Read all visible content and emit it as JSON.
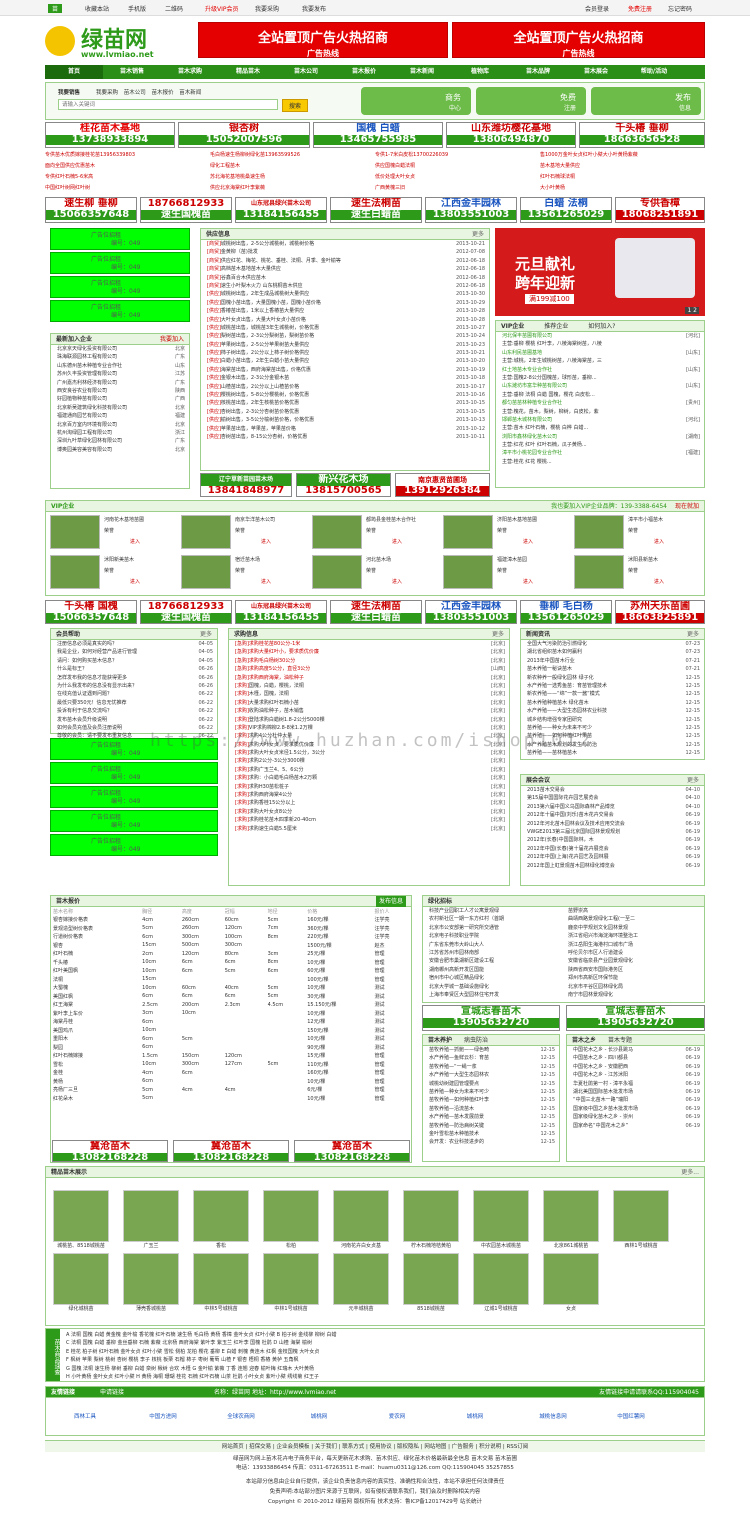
{
  "topbar": {
    "home": "收藏本站",
    "mobile": "手机版",
    "qr": "二维码",
    "vip": "升级VIP会员",
    "buy": "我要采购",
    "pub": "我要发布",
    "login": "会员登录",
    "reg": "免费注册",
    "forgot": "忘记密码"
  },
  "logo": {
    "name": "绿苗网",
    "url": "www.lvmiao.net"
  },
  "top_ads": [
    {
      "title": "全站置顶广告火热招商",
      "sub": "广告热线"
    },
    {
      "title": "全站置顶广告火热招商",
      "sub": "广告热线"
    }
  ],
  "nav": [
    "首页",
    "苗木销售",
    "苗木求购",
    "精品苗木",
    "苗木公司",
    "苗木报价",
    "苗木新闻",
    "植物库",
    "苗木品牌",
    "苗木展会",
    "帮助/活动"
  ],
  "search": {
    "label": "我要销售",
    "tabs": [
      "我要采购",
      "苗木公司",
      "苗木报价",
      "苗木新闻"
    ],
    "placeholder": "请输入关键词",
    "button": "搜索"
  },
  "quick": [
    {
      "a": "商",
      "b": "务",
      "c": "中心"
    },
    {
      "a": "免",
      "b": "费",
      "c": "注册"
    },
    {
      "a": "发",
      "b": "布",
      "c": "信息"
    }
  ],
  "banners1": [
    {
      "a": "桂花苗木基地",
      "b": "13738933894"
    },
    {
      "a": "银杏树",
      "b": "15052007596"
    },
    {
      "a": "国槐 白蜡",
      "b": "13465755985"
    },
    {
      "a": "山东潍坊樱花基地",
      "b": "13806494870"
    },
    {
      "a": "千头椿 垂柳",
      "b": "18663656528"
    }
  ],
  "notice": [
    [
      "专供苗木优质嫁接桂花苗13956339803",
      "毛白杨速生杨柳树绿化苗13963599526",
      "专供1-7米白皮松13700226039",
      "售1000万金叶女贞红叶小檗大小叶黄杨紫薇"
    ],
    [
      "面向全国供应优惠苗木",
      "绿化工程苗木",
      "供应国槐白蜡法桐",
      "苗木基地大量供应"
    ],
    [
      "专供红叶石楠5-6米高",
      "苏北海花基地桃桑速生杨",
      "低价处理大叶女贞",
      "红叶石楠球法桐"
    ],
    [
      "中国红叶树网红叶树",
      "供应北京海棠红叶李紫薇",
      "广西黄槐三旧",
      "大小叶黄杨"
    ]
  ],
  "banners2": [
    {
      "a": "速生柳 垂柳",
      "b": "15066357648"
    },
    {
      "a": "18766812933",
      "b": "速生国槐苗"
    },
    {
      "a": "山东冠县绿兴苗木公司",
      "b": "13184156455"
    },
    {
      "a": "速生法桐苗",
      "b": "速生白蜡苗"
    },
    {
      "a": "江西金丰园林",
      "b": "13803551003"
    },
    {
      "a": "白蜡 法桐",
      "b": "13561265029"
    },
    {
      "a": "专供香樟",
      "b": "18068251891"
    }
  ],
  "ad_slots": {
    "label": "广告位招租",
    "code": "编号：049"
  },
  "new_companies": {
    "title": "最新加入企业",
    "more": "我要加入",
    "items": [
      [
        "北京京天绿化投资有限公司",
        "北京"
      ],
      [
        "珠海联源园林工程有限公司",
        "广东"
      ],
      [
        "山东德州苗木种植专业合作社",
        "山东"
      ],
      [
        "苏州久丰投资管理有限公司",
        "江苏"
      ],
      [
        "广州嘉杰利林经济有限公司",
        "广东"
      ],
      [
        "西安良谷农业有限公司",
        "陕西"
      ],
      [
        "好园植物种苗有限公司",
        "广西"
      ],
      [
        "北京新吴建筑绿化科技有限公司",
        "北京"
      ],
      [
        "福建通商园艺有限公司",
        "福建"
      ],
      [
        "北京百方室内环境有限公司",
        "北京"
      ],
      [
        "杭州淘绿园工程有限公司",
        "浙江"
      ],
      [
        "深圳九叶草绿化园林有限公司",
        "广东"
      ],
      [
        "博奥园美容美容有限公司",
        "北京"
      ]
    ]
  },
  "supply": {
    "title": "供应信息",
    "more": "更多",
    "items": [
      [
        "[商贸]",
        "城桃树出售，2-5公分城桃树，城桃树价格",
        "2013-10-21"
      ],
      [
        "[商贸]",
        "金黄柳（苗)批发",
        "2012-07-08"
      ],
      [
        "[商贸]",
        "供应红花、梅花、桃花、垂桂、法桐、月季、金叶榆等",
        "2012-06-18"
      ],
      [
        "[商贸]",
        "高档苗木基地苗木大量供应",
        "2012-06-18"
      ],
      [
        "[商贸]",
        "谷鑫百合木供应苗木",
        "2012-06-18"
      ],
      [
        "[商贸]",
        "速生小叶梨木火力 山东桃桐苗木供应",
        "2012-06-18"
      ],
      [
        "[供应]",
        "城桃树出售，2年生成品城桃树大量供应",
        "2013-10-30"
      ],
      [
        "[供应]",
        "国槐小苗出售，大量国槐小苗，国槐小苗价格",
        "2013-10-29"
      ],
      [
        "[供应]",
        "香椿苗出售，1米以上香椿苗大量供应",
        "2013-10-28"
      ],
      [
        "[供应]",
        "大叶女贞出售，大量大叶女贞小苗价格",
        "2013-10-28"
      ],
      [
        "[供应]",
        "城桃苗出售，城桃苗3年生城桃树，价格优惠",
        "2013-10-27"
      ],
      [
        "[供应]",
        "梨树苗出售，2-3公分梨树苗，梨树苗价格",
        "2013-10-24"
      ],
      [
        "[供应]",
        "苹果树出售，2-5公分苹果树苗大量供应",
        "2013-10-23"
      ],
      [
        "[供应]",
        "柿子树出售，2公分以上柿子树价格供应",
        "2013-10-21"
      ],
      [
        "[供应]",
        "白蜡小苗出售，2年生白蜡小苗大量供应",
        "2013-10-20"
      ],
      [
        "[供应]",
        "海棠苗出售，西府海棠苗出售，价格优惠",
        "2013-10-19"
      ],
      [
        "[供应]",
        "金银木出售，2-3公分金银木苗",
        "2013-10-18"
      ],
      [
        "[供应]",
        "山楂苗出售，2公分以上山楂苗价格",
        "2013-10-17"
      ],
      [
        "[供应]",
        "樱桃树出售，5-8公分樱桃树，价格优惠",
        "2013-10-16"
      ],
      [
        "[供应]",
        "核桃苗出售，2年生核桃苗价格优惠",
        "2013-10-15"
      ],
      [
        "[供应]",
        "杏树出售，2-3公分杏树苗价格优惠",
        "2013-10-15"
      ],
      [
        "[供应]",
        "榆树出售，3-5公分榆树苗价格，价格优惠",
        "2013-10-13"
      ],
      [
        "[供应]",
        "苹果苗出售，苹果苗，苹果苗价格",
        "2013-10-12"
      ],
      [
        "[供应]",
        "杏树苗出售，8-15公分杏树，价格优惠",
        "2013-10-11"
      ]
    ]
  },
  "promo": {
    "t1": "元旦献礼",
    "t2": "跨年迎新",
    "t3": "满199减100",
    "pages": "1 2"
  },
  "vip_tabs": [
    "VIP企业",
    "推荐企业",
    "如何加入?"
  ],
  "vip_list": [
    [
      "河北保丰苗圃有限公司",
      "[河北]"
    ],
    [
      "主营:垂柳 樱桃 红叶李，八棱海棠树苗，八棱",
      ""
    ],
    [
      "山东利民苗圃基地",
      "[山东]"
    ],
    [
      "主营:城桃，2年生城桃树苗，八棱海棠苗，三",
      ""
    ],
    [
      "红土地苗木专业合作社",
      "[山东]"
    ],
    [
      "主营:国槐2-8公分国槐苗，球形苗，垂柳...",
      ""
    ],
    [
      "山东潍坊市富华种苗有限公司",
      "[山东]"
    ],
    [
      "主营:垂柳 法桐 白蜡 国槐，樱花 白皮松...",
      ""
    ],
    [
      "都匀苗苗林种植专业合作社",
      "[贵州]"
    ],
    [
      "主营:槐花，苗木，梨树，柳树，白皮松，紫",
      ""
    ],
    [
      "邯郸苗木城林有限公司",
      "[河北]"
    ],
    [
      "主营:苗木 红叶石楠，樱桃 白桦 白蜡...",
      ""
    ],
    [
      "浏阳市鑫林绿化苗木公司",
      "[湖南]"
    ],
    [
      "主营:红花 红叶 红叶石楠，瓜子黄杨...",
      ""
    ],
    [
      "漳平市小桃花园专业合作社",
      "[福建]"
    ],
    [
      "主营:桂花 红花 樱桃...",
      ""
    ]
  ],
  "banners3": [
    {
      "a": "辽宁草新苗园苗木场",
      "b": "13841848977"
    },
    {
      "a": "新兴花木场",
      "b": "13815700565"
    },
    {
      "a": "南京惠贤苗圃场",
      "b": "13912926384"
    }
  ],
  "vip_enterprise": {
    "title": "VIP企业",
    "right": "我也要加入VIP企业品牌：139-3388-6454",
    "more": "现在就加",
    "items": [
      {
        "n": "河南花木基地苗圃",
        "r": "荣誉",
        "p": "进入"
      },
      {
        "n": "南京华洋苗木公司",
        "r": "荣誉",
        "p": "进入"
      },
      {
        "n": "都筠县金桂苗木合作社",
        "r": "荣誉",
        "p": "进入"
      },
      {
        "n": "济阳苗木基地苗圃",
        "r": "荣誉",
        "p": "进入"
      },
      {
        "n": "漳平市小福苗木",
        "r": "荣誉",
        "p": "进入"
      },
      {
        "n": "沭阳新美苗木",
        "r": "荣誉",
        "p": "进入"
      },
      {
        "n": "宿迁苗木场",
        "r": "荣誉",
        "p": "进入"
      },
      {
        "n": "河北苗木场",
        "r": "荣誉",
        "p": "进入"
      },
      {
        "n": "福建漳木苗园",
        "r": "荣誉",
        "p": "进入"
      },
      {
        "n": "沭阳县新苗木",
        "r": "荣誉",
        "p": "进入"
      }
    ]
  },
  "banners4": [
    {
      "a": "千头椿 国槐",
      "b": "15066357648"
    },
    {
      "a": "18766812933",
      "b": "速生国槐苗"
    },
    {
      "a": "山东冠县绿兴苗木公司",
      "b": "13184156455"
    },
    {
      "a": "速生法桐苗",
      "b": "速生白蜡苗"
    },
    {
      "a": "江西金丰园林",
      "b": "13803551003"
    },
    {
      "a": "垂柳 毛白杨",
      "b": "13561265029"
    },
    {
      "a": "苏州天乐苗圃",
      "b": "18663825891"
    }
  ],
  "help": {
    "title": "会员帮助",
    "more": "更多",
    "items": [
      [
        "注册信息必须是真实的吗？",
        "04-05"
      ],
      [
        "我是企业，如何对经营产品进行管理",
        "04-05"
      ],
      [
        "请问：如何购买苗木信息？",
        "04-05"
      ],
      [
        "什么是标王？",
        "06-26"
      ],
      [
        "怎样发布我的信息才能获得更多",
        "06-26"
      ],
      [
        "为什么我发布的信息没有显示出来？",
        "06-26"
      ],
      [
        "在线充值认证遇到问题？",
        "06-22"
      ],
      [
        "最低只要350元！信息无忧推荐",
        "06-22"
      ],
      [
        "投诉有利于信息交流吗？",
        "06-22"
      ],
      [
        "发布苗木会员升级说明",
        "06-22"
      ],
      [
        "如何会员充值及会员注册说明",
        "06-22"
      ],
      [
        "尊敬的会员：请不要发布重复信息",
        "06-22"
      ]
    ]
  },
  "buying": {
    "title": "求购信息",
    "more": "更多",
    "items": [
      [
        "[急购]",
        "求购桂花苗80公分-1米",
        "[北京]"
      ],
      [
        "[急购]",
        "求购大量红叶小，要求质优价廉",
        "[北京]"
      ],
      [
        "[急购]",
        "求购毛白杨树30公分",
        "[北京]"
      ],
      [
        "[急购]",
        "求购高度5公分，直径3公分",
        "[山西]"
      ],
      [
        "[急购]",
        "求购西府海棠，油松种子",
        "[北京]"
      ],
      [
        "[求购]",
        "国槐，白蜡，樱桃，法桐",
        "[北京]"
      ],
      [
        "[求购]",
        "木槿，国槐，法桐",
        "[北京]"
      ],
      [
        "[求购]",
        "大量求购红叶石楠小苗",
        "[北京]"
      ],
      [
        "[求购]",
        "收购油松种子，苗木销售",
        "[北京]"
      ],
      [
        "[求购]",
        "登陆求购白蜡树1.8-2公分5000棵",
        "[北京]"
      ],
      [
        "[求购]",
        "VIP求购棉柳2.8-8米1.2万棵",
        "[北京]"
      ],
      [
        "[求购]",
        "求购4公分杜仲大量",
        "[北京]"
      ],
      [
        "[求购]",
        "求购大叶女贞，要求质优价廉",
        "[北京]"
      ],
      [
        "[求购]",
        "求购大叶女贞米径1.5公分，3公分",
        "[北京]"
      ],
      [
        "[求购]",
        "求购2公分-3公分3000棵",
        "[北京]"
      ],
      [
        "[求购]",
        "求购广玉兰4、5、6公分",
        "[北京]"
      ],
      [
        "[求购]",
        "求购：小白蜡毛白杨苗木2万颗",
        "[北京]"
      ],
      [
        "[求购]",
        "求购H30苗松桩子",
        "[北京]"
      ],
      [
        "[求购]",
        "求购西府海棠4公分",
        "[北京]"
      ],
      [
        "[求购]",
        "求购香桂15公分以上",
        "[北京]"
      ],
      [
        "[求购]",
        "求购大叶女贞8公分",
        "[北京]"
      ],
      [
        "[求购]",
        "求购桂花苗木四季新20-40cm",
        "[北京]"
      ],
      [
        "[求购]",
        "求购速生白蜡5.5厘米",
        "[北京]"
      ]
    ]
  },
  "news": {
    "title": "新闻资讯",
    "more": "更多",
    "items": [
      [
        "全国大气污染防治引燃绿化",
        "07-23"
      ],
      [
        "湖北省组织苗木如何赢利",
        "07-23"
      ],
      [
        "2013年中国苗木行业",
        "07-21"
      ],
      [
        "苗木养殖一秘诀苗木",
        "07-21"
      ],
      [
        "新农种养一般绿化园林 绿子化",
        "12-15"
      ],
      [
        "水产养殖一选秀鱼苗：育苗管理技术",
        "12-15"
      ],
      [
        "新农养殖——“绵”一款一酱“模式",
        "12-15"
      ],
      [
        "苗木养殖种植苗木 绿化苗木",
        "12-15"
      ],
      [
        "水产养殖——大型生态园林农业科技",
        "12-15"
      ],
      [
        "城乡结构增强专家团研究",
        "12-15"
      ],
      [
        "苗养殖——种女为未来不可少",
        "12-15"
      ],
      [
        "苗养殖——如何种植红叶果苗",
        "12-15"
      ],
      [
        "水产养殖苗木规划的发生与防治",
        "12-15"
      ],
      [
        "苗养殖——苗林植苗木",
        "12-15"
      ]
    ]
  },
  "expo": {
    "title": "展会会议",
    "more": "更多",
    "items": [
      [
        "2013苗木交易会",
        "04-10"
      ],
      [
        "第15届中国国际花卉园艺展览会",
        "04-10"
      ],
      [
        "2013第六届中国义乌国际森林产品博览",
        "04-10"
      ],
      [
        "2012年十届中国(刘乐)苗木花卉交易会",
        "06-19"
      ],
      [
        "2012年河北苗木园林会议及技术应用交流会",
        "06-19"
      ],
      [
        "VWGE2013第三届北京国际园林景观规划",
        "06-19"
      ],
      [
        "2012年(长春)中国国际林，木",
        "06-19"
      ],
      [
        "2012年中国(长春)第十届花卉展览会",
        "06-19"
      ],
      [
        "2012年中国(上海)花卉园艺及园林展",
        "06-19"
      ],
      [
        "2012年国上虹景观苗木园林绿化博览会",
        "06-19"
      ]
    ]
  },
  "price": {
    "title": "苗木报价",
    "btn": "发布信息",
    "cols": [
      "苗木名称",
      "胸径",
      "高度",
      "冠幅",
      "地径",
      "价格",
      "报价人"
    ],
    "rows": [
      [
        "银杏嫁接价格表",
        "4cm",
        "260cm",
        "60cm",
        "5cm",
        "160元/棵",
        "汪学亮"
      ],
      [
        "景观造型树价格表",
        "5cm",
        "260cm",
        "120cm",
        "7cm",
        "360元/棵",
        "汪学亮"
      ],
      [
        "行道树价格表",
        "6cm",
        "300cm",
        "100cm",
        "8cm",
        "220元/棵",
        "汪学亮"
      ],
      [
        "银杏",
        "15cm",
        "500cm",
        "300cm",
        "",
        "1500元/棵",
        "赵杰"
      ],
      [
        "红叶石楠",
        "2cm",
        "120cm",
        "80cm",
        "3cm",
        "25元/棵",
        "管理"
      ],
      [
        "千头椿",
        "10cm",
        "6cm",
        "6cm",
        "8cm",
        "10元/棵",
        "管理"
      ],
      [
        "红叶美国枫",
        "10cm",
        "6cm",
        "5cm",
        "6cm",
        "60元/棵",
        "管理"
      ],
      [
        "法桐",
        "15cm",
        "",
        "",
        "",
        "100元/棵",
        "管理"
      ],
      [
        "大蜀槐",
        "10cm",
        "60cm",
        "40cm",
        "5cm",
        "10元/棵",
        "测试"
      ],
      [
        "美国红枫",
        "6cm",
        "6cm",
        "6cm",
        "5cm",
        "30元/棵",
        "测试"
      ],
      [
        "红王海棠",
        "2.5cm",
        "200cm",
        "2.3cm",
        "4.5cm",
        "15.150元/棵",
        "测试"
      ],
      [
        "紫叶李上车价",
        "3cm",
        "10cm",
        "",
        "",
        "10元/棵",
        "测试"
      ],
      [
        "海棠丹桂",
        "6cm",
        "",
        "",
        "",
        "12元/棵",
        "测试"
      ],
      [
        "美国鸡爪",
        "10cm",
        "",
        "",
        "",
        "150元/棵",
        "测试"
      ],
      [
        "重阳木",
        "6cm",
        "5cm",
        "",
        "",
        "10元/棵",
        "测试"
      ],
      [
        "梨园",
        "6cm",
        "",
        "",
        "",
        "90元/棵",
        "测试"
      ],
      [
        "红叶石楠嫁接",
        "1.5cm",
        "150cm",
        "120cm",
        "",
        "15元/棵",
        "管理"
      ],
      [
        "雪松",
        "10cm",
        "300cm",
        "127cm",
        "5cm",
        "110元/棵",
        "管理"
      ],
      [
        "金桂",
        "4cm",
        "6cm",
        "",
        "",
        "160元/棵",
        "管理"
      ],
      [
        "黄杨",
        "6cm",
        "",
        "",
        "",
        "10元/棵",
        "管理"
      ],
      [
        "亮杨厂三旦",
        "5cm",
        "4cm",
        "4cm",
        "",
        "6元/棵",
        "管理"
      ],
      [
        "红花朵木",
        "5cm",
        "",
        "",
        "",
        "10元/棵",
        "管理"
      ]
    ]
  },
  "banners5": [
    {
      "a": "冀沧苗木",
      "b": "13082168228"
    },
    {
      "a": "冀沧苗木",
      "b": "13082168228"
    },
    {
      "a": "冀沧苗木",
      "b": "13082168228"
    }
  ],
  "green": {
    "title": "绿化招标",
    "items": [
      [
        "科技产业园职工人才公寓景观绿",
        "苗野崇高",
        "四期绿化及景观工程第一期"
      ],
      [
        "农村新社区一期一东方红村（首期",
        "曲靖西路景观绿化工程(一至二"
      ],
      [
        "北京市公安部第一研究所交通管",
        "鹿泉中学规划文化园林景观"
      ],
      [
        "北京电子科技职业学院",
        "浙江省绍兴市海淀海环境整治工"
      ],
      [
        "广东省东莞市大岭山大人",
        "浙江岳阳生海港村口城市广场"
      ],
      [
        "江苏省苏州市园林南部",
        "呼伦贝尔市区人行道建设"
      ],
      [
        "安徽合肥市巢湖新区建设工程",
        "安徽省临泉县产业园景观绿化"
      ],
      [
        "湖南郴州高新开发区国能",
        "陕西省西安市国际港务区"
      ],
      [
        "宿州市中心城区精品绿化",
        "郑州市高新区环保节能"
      ],
      [
        "北京大学城一基础设施绿化",
        "北京市平谷区园林绿化局"
      ],
      [
        "上海市奉贤区大型园林住宅开发",
        "南宁市园林景观绿化"
      ]
    ]
  },
  "banners6": [
    {
      "a": "宣城志春苗木",
      "b": "13905632720"
    },
    {
      "a": "宣城志春苗木",
      "b": "13905632720"
    }
  ],
  "tips": {
    "tabs": [
      "苗木养护",
      "病虫防治"
    ],
    "items": [
      [
        "苗牧养殖—抓鲍——绿色畸",
        "12-15"
      ],
      [
        "水产养殖—鱼鲜云杉：育苗",
        "12-15"
      ],
      [
        "苗牧养殖—“一绳一浆",
        "12-15"
      ],
      [
        "水产养殖一大型生态园林农",
        "12-15"
      ],
      [
        "城桃幼树建园管理要点",
        "12-15"
      ],
      [
        "苗养殖—种女为未来不可少",
        "12-15"
      ],
      [
        "苗牧养殖—如何种植红叶李",
        "12-15"
      ],
      [
        "苗牧养殖—沿流苗木",
        "12-15"
      ],
      [
        "水产养殖—苗木发展前景",
        "12-15"
      ],
      [
        "苗牧养殖—防治病树关键",
        "12-15"
      ],
      [
        "金叶雪松苗木种植技术",
        "12-15"
      ],
      [
        "会开发：农业科技进步的",
        "12-15"
      ]
    ]
  },
  "china": {
    "tabs": [
      "苗木之乡",
      "苗木专题"
    ],
    "items": [
      [
        "中国花木之乡 - 长沙县跳马",
        "06-19"
      ],
      [
        "中国苗木之乡 - 四川都县",
        "06-19"
      ],
      [
        "中国花木之乡 - 安徽肥西",
        "06-19"
      ],
      [
        "中国花木之乡 - 江苏沭阳",
        "06-19"
      ],
      [
        "华夏杜鹃第一村 - 漳平永福",
        "06-19"
      ],
      [
        "湖北美国国际苗木批发市场",
        "06-19"
      ],
      [
        "“中国三北苗木一路”瑞阳",
        "06-19"
      ],
      [
        "国家级中国之乡苗木批发市场",
        "06-19"
      ],
      [
        "国家级绿化苗木之乡 - 崇州",
        "06-19"
      ],
      [
        "国家命名“中国花木之乡”",
        "06-19"
      ]
    ]
  },
  "gallery": {
    "title": "精品苗木展示",
    "more": "更多...",
    "row1": [
      "城桃苗、8518城桃苗",
      "广玉兰",
      "香松",
      "松柏",
      "河南花卉白女贞基",
      "柠木石楠地桔黄柏",
      "中农园苗木城桃苗",
      "北京861城桃苗",
      "西林1号城桃苗"
    ],
    "row2": [
      "绿化城桃苗",
      "薄壳香城桃苗",
      "中林5号城桃苗",
      "中林1号城桃苗",
      "元丰城桃苗",
      "8518城桃苗",
      "辽城1号城桃苗",
      "女贞",
      ""
    ]
  },
  "index": {
    "label": "苗木商品速查",
    "lines": [
      "A 法桐 国槐 白蜡 黄金槐 金叶榆 香花槐 红叶石楠 速生杨 毛白杨 黄杨 香樟 金叶女贞 红叶小檗 B 柏子树 金线柳 柳树 白蜡",
      "C 法桐 国槐 白蜡 垂柳 金丝垂柳 石楠 紫薇 北京杨 西府海棠 紫叶李 紫玉兰 红叶李 国槐 杜鹃 D 山楂 海棠 榆树",
      "E 桂花 柏子树 红叶石楠 金叶女贞 红叶小檗 雪松 侧柏 龙柏 樱花 垂柳 E 白蜡 刺槐 黄连木 红枫 金枝国槐 大叶女贞",
      "F 枫树 苹果 梨树 桃树 杏树 樱桃 李子 核桃 板栗 石榴 柿子 枣树 葡萄 山楂 F 银杏 梧桐 香椿 黄栌 五角枫",
      "G 国槐 法桐 速生杨 柳树 垂柳 白蜡 栾树 楸树 合欢 木槿 G 金叶榆 紫薇 丁香 连翘 迎春 榆叶梅 红瑞木 大叶黄杨",
      "H 小叶黄杨 金叶女贞 红叶小檗 H 黄杨 海桐 珊瑚 桂花 石楠 红叶石楠 山茶 杜鹃 小叶女贞 紫叶小檗 绣线菊 红王子"
    ]
  },
  "links": {
    "title": "友情链接",
    "apply": "申请链接",
    "site": "名称：绿苗网 地址：http://www.lvmiao.net",
    "qq": "友情链接申请请联系QQ:115904045",
    "logos": [
      "西林工具",
      "中国方进网",
      "全球农商网",
      "城桃网",
      "爱农网",
      "城桃网",
      "城桃信息网",
      "中国红薯网"
    ]
  },
  "footer": {
    "nav": [
      "网站首页",
      "招保交易",
      "企业会员模板",
      "关于我们",
      "联系方式",
      "使用协议",
      "版权隐私",
      "网站地图",
      "广告服务",
      "积分说明",
      "RSS订阅"
    ],
    "line1": "网站首页 招保交易 企业会员模板",
    "contact": "电话：13933886454 传真：0311-67263511 E-mail：huamu0311@126.com QQ:115904045 35257855",
    "l2": "绿苗网为网上苗木花卉电子商务平台，每天更新花木求购、苗木供应、绿化苗木价格最新最全信息 苗木交易 苗木苗圃",
    "l3": "本站部分信息由企业自行提供，该企业负责信息内容的真实性、准确性和合法性，本站不承担任何法律责任",
    "l4": "免责声明:本站部分图片来源于互联网，如有侵权请联系我们，我们会及时删除相关内容",
    "l5": "Copyright © 2010-2012 绿苗网 版权所有 技术支持：鲁ICP备12017429号 站长统计"
  },
  "watermark": "https://www.huzhan.com/ishop1012"
}
